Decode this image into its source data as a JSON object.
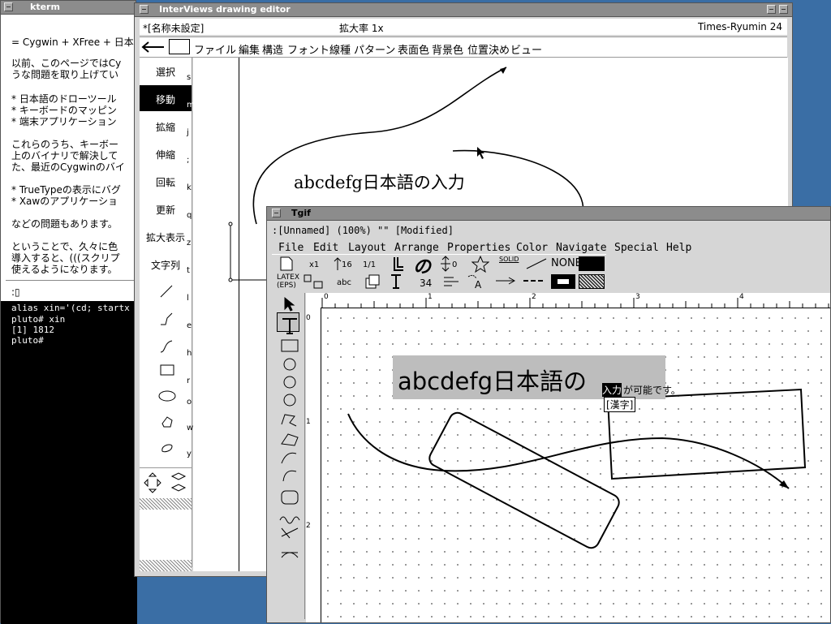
{
  "desktop": {
    "background_color": "#3a6ea5"
  },
  "kterm": {
    "title": "kterm",
    "lines": [
      "= Cygwin + XFree + 日本",
      "以前、このページではCy",
      "うな問題を取り上げてい",
      "* 日本語のドローツール",
      "* キーボードのマッピン",
      "* 端末アプリケーション",
      "これらのうち、キーボー",
      "上のバイナリで解決して",
      "た、最近のCygwinのバイ",
      "* TrueTypeの表示にバグ",
      "* Xawのアプリケーショ",
      "などの問題もあります。",
      "ということで、久々に色",
      "導入すると、(((スクリプ",
      "使えるようになります。",
      ":▯"
    ],
    "shell": [
      "alias xin='(cd; startx >",
      "pluto# xin",
      "[1] 1812",
      "pluto#"
    ]
  },
  "interviews": {
    "title": "InterViews drawing editor",
    "doc_name": "*[名称未設定]",
    "zoom": "拡大率 1x",
    "font": "Times-Ryumin 24",
    "menu": [
      "ファイル",
      "編集",
      "構造",
      "フォント",
      "線種",
      "パターン",
      "表面色",
      "背景色",
      "位置決め",
      "ビュー"
    ],
    "tools": [
      {
        "label": "選択",
        "key": "s"
      },
      {
        "label": "移動",
        "key": "m"
      },
      {
        "label": "拡縮",
        "key": "j"
      },
      {
        "label": "伸縮",
        "key": ";"
      },
      {
        "label": "回転",
        "key": "k"
      },
      {
        "label": "更新",
        "key": "q"
      },
      {
        "label": "拡大表示",
        "key": "z"
      },
      {
        "label": "文字列",
        "key": "t"
      }
    ],
    "shape_keys": [
      "l",
      "e",
      "h",
      "r",
      "o",
      "w",
      "y"
    ],
    "selected_tool": "移動",
    "canvas_text": "abcdefg日本語の入力"
  },
  "tgif": {
    "title": "Tgif",
    "status": ":[Unnamed] (100%) \"\" [Modified]",
    "menu": [
      "File",
      "Edit",
      "Layout",
      "Arrange",
      "Properties",
      "Color",
      "Navigate",
      "Special",
      "Help"
    ],
    "choices": {
      "zoom": "x1",
      "font_size_arrow": "16",
      "ratio": "1/1",
      "font_char": "の",
      "spacing": "0",
      "solid": "SOLID",
      "none": "NONE",
      "latex": "LATEX",
      "eps": "(EPS)",
      "abc": "abc",
      "size": "34"
    },
    "ruler_labels": [
      "0",
      "1",
      "2",
      "3",
      "4"
    ],
    "vruler_labels": [
      "0",
      "1",
      "2"
    ],
    "canvas_text": "abcdefg日本語の",
    "preedit": "入力",
    "preedit_rest": "が可能です。",
    "conversion": "[漢字]",
    "side_tools": [
      "select-arrow-icon",
      "text-tool-icon",
      "rectangle-icon",
      "oval-center-icon",
      "oval-corner-icon",
      "oval-edge-icon",
      "poly-icon",
      "polygon-icon",
      "arc-icon",
      "arc-edge-icon",
      "rounded-rect-icon",
      "freehand-icon",
      "vertex-icon",
      "rotate-icon"
    ]
  }
}
